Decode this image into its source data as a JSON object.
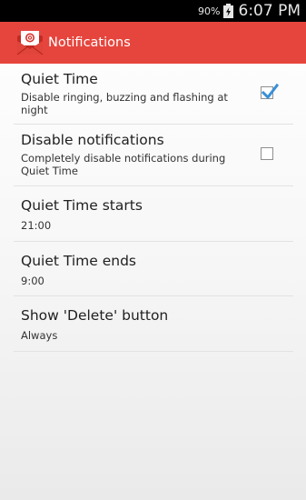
{
  "status_bar": {
    "battery_percent": "90%",
    "time": "6:07 PM"
  },
  "action_bar": {
    "title": "Notifications",
    "icon": "mail-envelope-icon"
  },
  "settings": [
    {
      "title": "Quiet Time",
      "summary": "Disable ringing, buzzing and flashing at night",
      "checked": true
    },
    {
      "title": "Disable notifications",
      "summary": "Completely disable notifications during Quiet Time",
      "checked": false
    },
    {
      "title": "Quiet Time starts",
      "summary": "21:00"
    },
    {
      "title": "Quiet Time ends",
      "summary": "9:00"
    },
    {
      "title": "Show 'Delete' button",
      "summary": "Always"
    }
  ],
  "colors": {
    "action_bar": "#e6453d",
    "check_accent": "#3a8fd6"
  }
}
